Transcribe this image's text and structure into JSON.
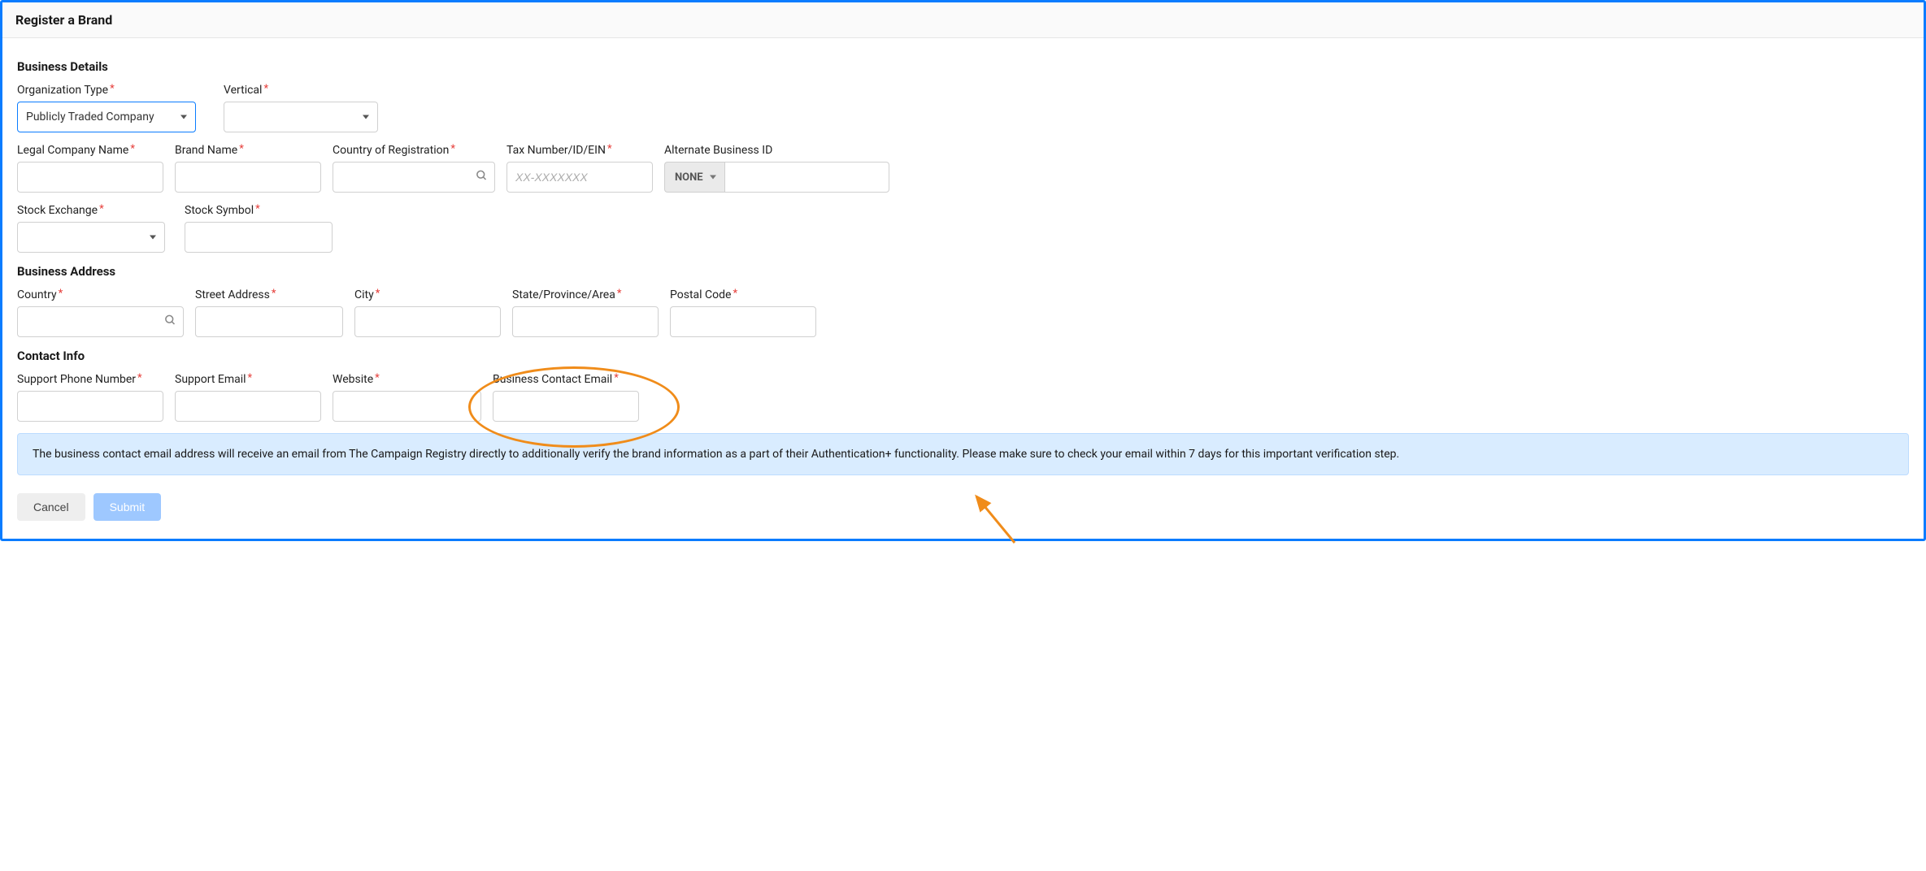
{
  "header": {
    "title": "Register a Brand"
  },
  "sections": {
    "business_details": "Business Details",
    "business_address": "Business Address",
    "contact_info": "Contact Info"
  },
  "fields": {
    "org_type": {
      "label": "Organization Type",
      "value": "Publicly Traded Company"
    },
    "vertical": {
      "label": "Vertical",
      "value": ""
    },
    "legal_name": {
      "label": "Legal Company Name"
    },
    "brand_name": {
      "label": "Brand Name"
    },
    "country_reg": {
      "label": "Country of Registration"
    },
    "tax": {
      "label": "Tax Number/ID/EIN",
      "placeholder": "XX-XXXXXXX"
    },
    "alt_id": {
      "label": "Alternate Business ID",
      "selector": "NONE"
    },
    "stock_exchange": {
      "label": "Stock Exchange"
    },
    "stock_symbol": {
      "label": "Stock Symbol"
    },
    "country": {
      "label": "Country"
    },
    "street": {
      "label": "Street Address"
    },
    "city": {
      "label": "City"
    },
    "state": {
      "label": "State/Province/Area"
    },
    "postal": {
      "label": "Postal Code"
    },
    "support_phone": {
      "label": "Support Phone Number"
    },
    "support_email": {
      "label": "Support Email"
    },
    "website": {
      "label": "Website"
    },
    "biz_email": {
      "label": "Business Contact Email"
    }
  },
  "info": "The business contact email address will receive an email from The Campaign Registry directly to additionally verify the brand information as a part of their Authentication+ functionality. Please make sure to check your email within 7 days for this important verification step.",
  "buttons": {
    "cancel": "Cancel",
    "submit": "Submit"
  }
}
